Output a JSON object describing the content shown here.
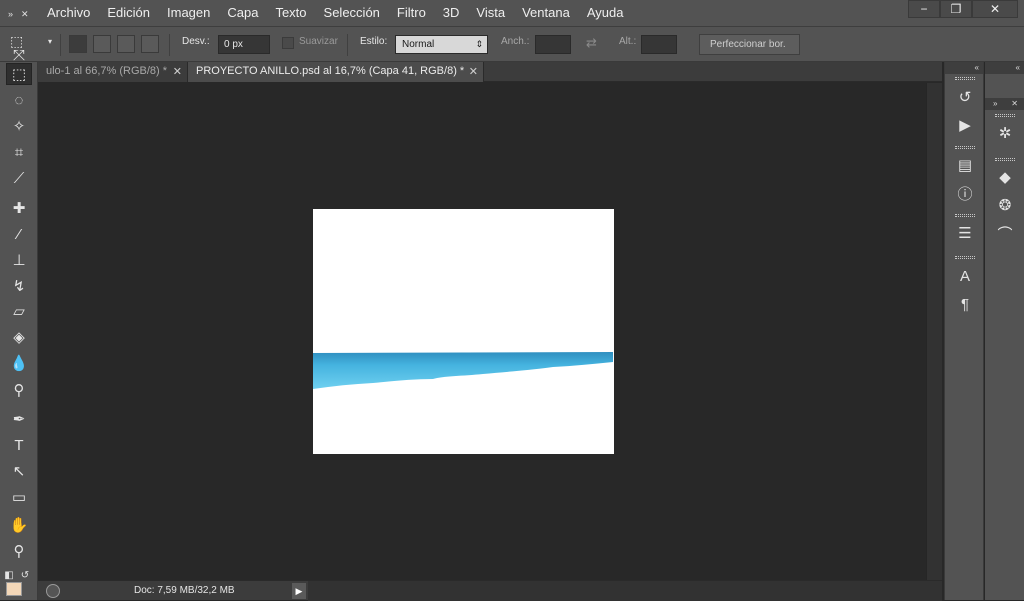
{
  "menubar": {
    "items": [
      "Archivo",
      "Edición",
      "Imagen",
      "Capa",
      "Texto",
      "Selección",
      "Filtro",
      "3D",
      "Vista",
      "Ventana",
      "Ayuda"
    ],
    "window_controls": [
      "−",
      "❐",
      "✕"
    ]
  },
  "options": {
    "desv_label": "Desv.:",
    "desv_value": "0 px",
    "suavizar_label": "Suavizar",
    "estilo_label": "Estilo:",
    "estilo_value": "Normal",
    "anch_label": "Anch.:",
    "alt_label": "Alt.:",
    "refine_button": "Perfeccionar bor."
  },
  "tabs": [
    {
      "label": "ulo-1 al 66,7% (RGB/8) *",
      "active": false
    },
    {
      "label": "PROYECTO ANILLO.psd al 16,7% (Capa 41, RGB/8) *",
      "active": true
    }
  ],
  "status": {
    "doc_info": "Doc: 7,59 MB/32,2 MB"
  },
  "colors": {
    "accent_blue": "#4fc0e8",
    "foreground": "#f3d7b8"
  },
  "icons": {
    "tools": [
      "move-icon",
      "marquee-icon",
      "lasso-icon",
      "magic-wand-icon",
      "crop-icon",
      "eyedropper-icon",
      "healing-brush-icon",
      "brush-icon",
      "stamp-icon",
      "history-brush-icon",
      "eraser-icon",
      "paint-bucket-icon",
      "blur-icon",
      "dodge-icon",
      "pen-icon",
      "type-icon",
      "path-selection-icon",
      "shape-icon",
      "hand-icon",
      "zoom-icon"
    ]
  }
}
